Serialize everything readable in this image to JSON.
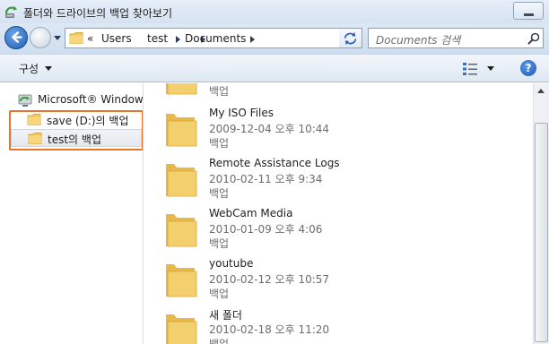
{
  "window": {
    "title": "폴더와 드라이브의 백업 찾아보기"
  },
  "address_bar": {
    "overflow": "«",
    "crumbs": [
      "Users",
      "test",
      "Documents"
    ]
  },
  "search": {
    "placeholder": "Documents 검색"
  },
  "toolbar": {
    "organize_label": "구성",
    "help_label": "?"
  },
  "nav_pane": {
    "root": "Microsoft® Windows",
    "items": [
      {
        "label": "save (D:)의 백업"
      },
      {
        "label": "test의 백업",
        "selected": true
      }
    ]
  },
  "files": {
    "partial_top": {
      "type": "백업"
    },
    "items": [
      {
        "name": "My ISO Files",
        "date": "2009-12-04 오후 10:44",
        "type": "백업"
      },
      {
        "name": "Remote Assistance Logs",
        "date": "2010-02-11 오후 9:34",
        "type": "백업"
      },
      {
        "name": "WebCam Media",
        "date": "2010-01-09 오후 4:06",
        "type": "백업"
      },
      {
        "name": "youtube",
        "date": "2010-02-12 오후 10:57",
        "type": "백업"
      },
      {
        "name": "새 폴더",
        "date": "2010-02-18 오후 11:20",
        "type": "백업"
      }
    ]
  },
  "colors": {
    "highlight": "#e8752a",
    "accent": "#1f5fb5",
    "folder": "#f2c85e"
  },
  "icons": {
    "app": "backup-restore-icon",
    "nav_root": "windows-backup-icon",
    "folder": "folder-icon",
    "search": "search-icon",
    "refresh": "refresh-icon",
    "views": "views-icon",
    "help": "help-icon"
  }
}
